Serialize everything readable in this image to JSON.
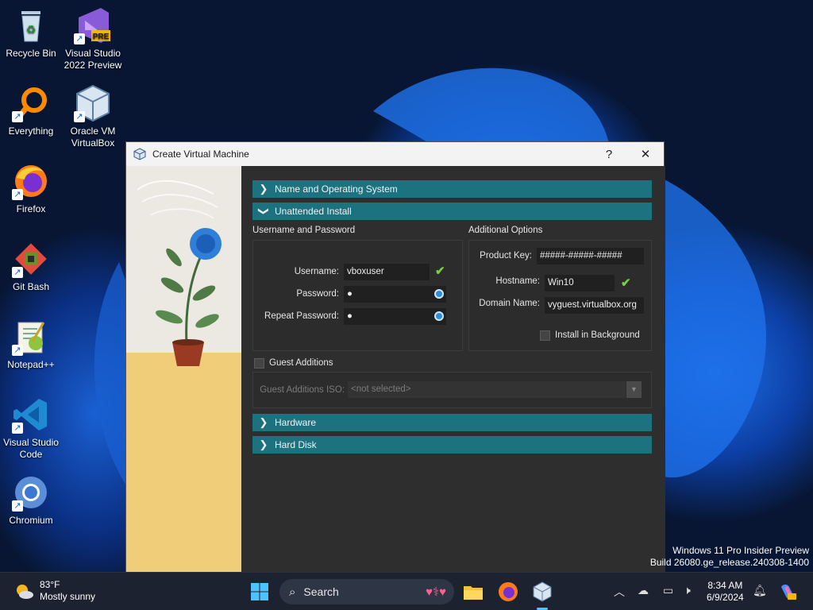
{
  "desktop": {
    "icons": [
      {
        "label": "Recycle Bin"
      },
      {
        "label": "Visual Studio 2022 Preview",
        "badge": "PRE"
      },
      {
        "label": "Everything"
      },
      {
        "label": "Oracle VM VirtualBox"
      },
      {
        "label": "Firefox"
      },
      {
        "label": "Git Bash"
      },
      {
        "label": "Notepad++"
      },
      {
        "label": "Visual Studio Code"
      },
      {
        "label": "Chromium"
      }
    ],
    "watermark_line1": "Windows 11 Pro Insider Preview",
    "watermark_line2": "Build 26080.ge_release.240308-1400"
  },
  "dialog": {
    "title": "Create Virtual Machine",
    "help_glyph": "?",
    "close_glyph": "✕",
    "sections": {
      "name_os": "Name and Operating System",
      "unattended": "Unattended Install",
      "hardware": "Hardware",
      "hard_disk": "Hard Disk"
    },
    "user_pass": {
      "group_label": "Username and Password",
      "username_label": "Username:",
      "username_value": "vboxuser",
      "password_label": "Password:",
      "password_value": "●",
      "repeat_label": "Repeat Password:",
      "repeat_value": "●"
    },
    "additional": {
      "group_label": "Additional Options",
      "product_key_label": "Product Key:",
      "product_key_value": "#####-#####-#####",
      "hostname_label": "Hostname:",
      "hostname_value": "Win10",
      "domain_label": "Domain Name:",
      "domain_value": "vyguest.virtualbox.org",
      "install_bg_label": "Install in Background",
      "install_bg_checked": false
    },
    "guest_additions": {
      "label": "Guest Additions",
      "checked": false,
      "iso_label": "Guest Additions ISO:",
      "iso_value": "<not selected>"
    }
  },
  "taskbar": {
    "weather_temp": "83°F",
    "weather_cond": "Mostly sunny",
    "search_label": "Search",
    "time": "8:34 AM",
    "date": "6/9/2024"
  },
  "colors": {
    "section_bar": "#1d7280",
    "dialog_bg": "#2e2e2e",
    "taskbar_bg": "#1c2230",
    "accent_check": "#7ccf3b"
  }
}
